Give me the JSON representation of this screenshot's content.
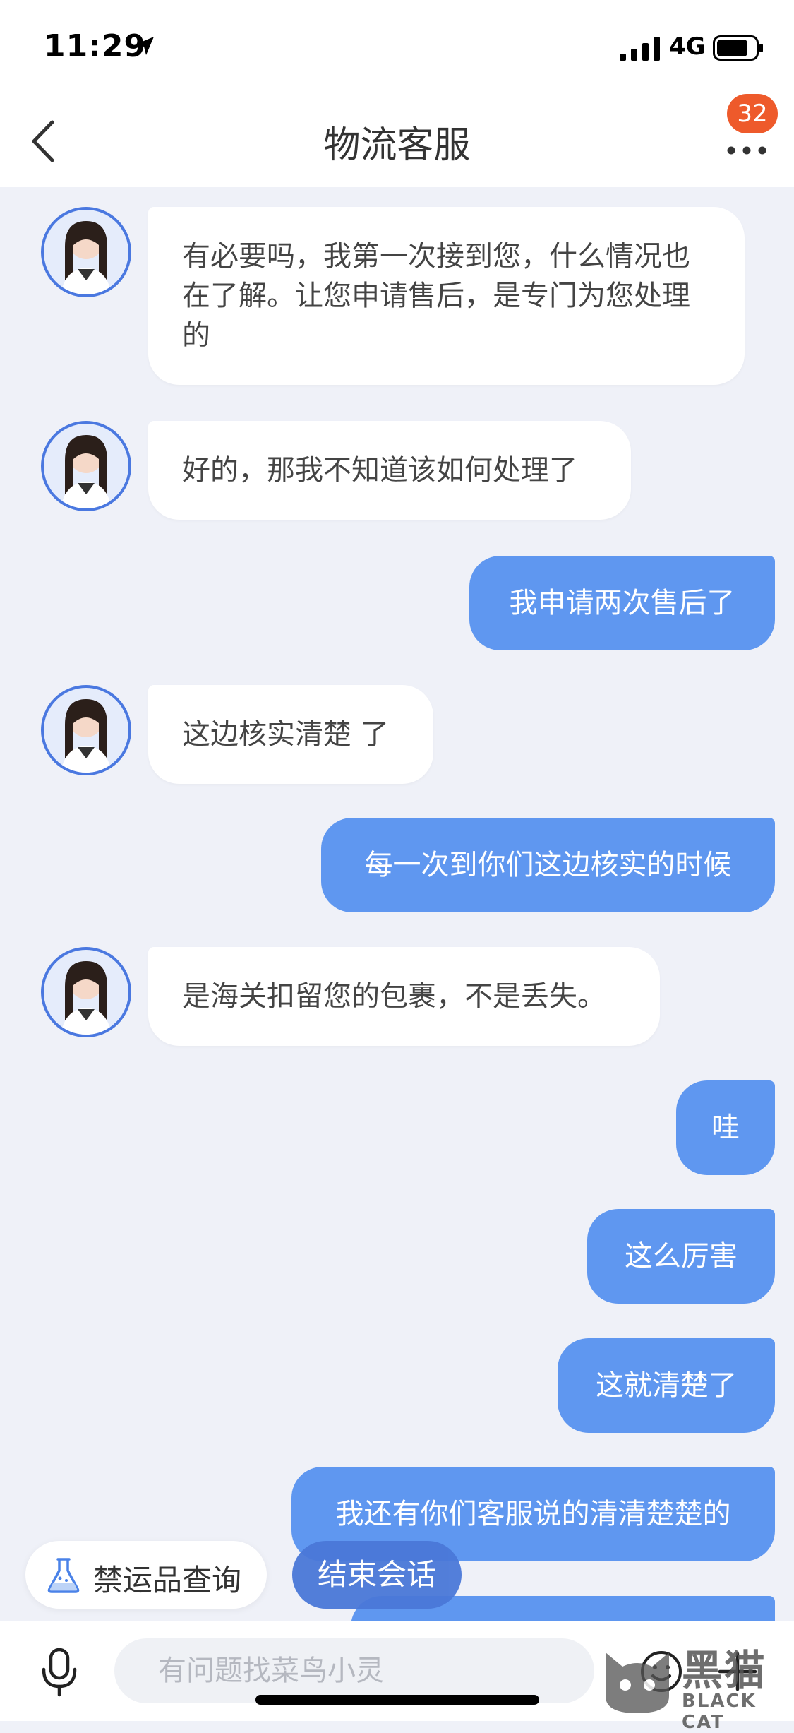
{
  "status_bar": {
    "time": "11:29",
    "network": "4G"
  },
  "nav": {
    "title": "物流客服",
    "badge_count": "32"
  },
  "messages": [
    {
      "from": "agent",
      "text": "有必要吗，我第一次接到您，什么情况也在了解。让您申请售后，是专门为您处理的"
    },
    {
      "from": "agent",
      "text": "好的，那我不知道该如何处理了"
    },
    {
      "from": "user",
      "text": "我申请两次售后了"
    },
    {
      "from": "agent",
      "text": "这边核实清楚 了"
    },
    {
      "from": "user",
      "text": "每一次到你们这边核实的时候"
    },
    {
      "from": "agent",
      "text": "是海关扣留您的包裹，不是丢失。"
    },
    {
      "from": "user",
      "text": "哇"
    },
    {
      "from": "user",
      "text": "这么厉害"
    },
    {
      "from": "user",
      "text": "这就清楚了"
    },
    {
      "from": "user",
      "text": "我还有你们客服说的清清楚楚的"
    },
    {
      "from": "user",
      "text": ""
    }
  ],
  "quick_actions": {
    "prohibited_lookup": "禁运品查询",
    "end_session": "结束会话"
  },
  "input": {
    "placeholder": "有问题找菜鸟小灵"
  },
  "watermark": {
    "zh": "黑猫",
    "en": "BLACK CAT"
  },
  "colors": {
    "user_bubble": "#5f97f0",
    "agent_bubble": "#ffffff",
    "badge": "#ee5a2b",
    "background": "#eff1f8"
  },
  "icons": [
    "location-arrow-icon",
    "signal-icon",
    "battery-icon",
    "back-chevron-icon",
    "more-dots-icon",
    "flask-icon",
    "microphone-icon",
    "emoji-icon",
    "plus-icon"
  ]
}
